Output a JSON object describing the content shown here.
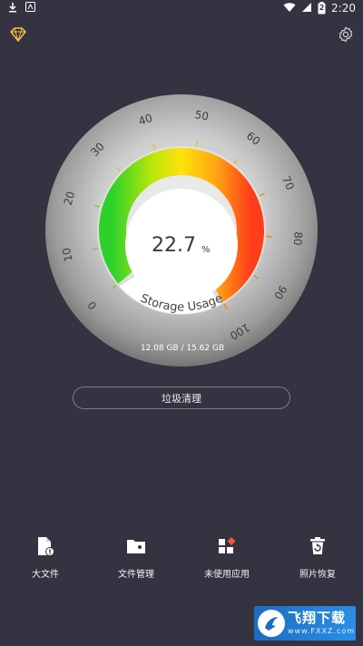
{
  "status_bar": {
    "time": "2:20",
    "battery": "2"
  },
  "icons": {
    "premium": "diamond-icon",
    "settings": "gear-icon",
    "download": "download-icon",
    "notification": "app-notification-icon",
    "wifi": "wifi-icon",
    "signal": "signal-icon",
    "battery": "battery-icon"
  },
  "gauge": {
    "percent_value": "22.7",
    "percent_unit": "%",
    "label": "Storage Usage",
    "storage_text": "12.08 GB / 15.62 GB",
    "ticks": [
      "0",
      "10",
      "20",
      "30",
      "40",
      "50",
      "60",
      "70",
      "80",
      "90",
      "100"
    ],
    "usage_fraction": 0.227
  },
  "actions": {
    "clean_label": "垃圾清理"
  },
  "bottom_nav": [
    {
      "label": "大文件",
      "icon": "large-file-icon"
    },
    {
      "label": "文件管理",
      "icon": "folder-icon"
    },
    {
      "label": "未使用应用",
      "icon": "unused-apps-icon"
    },
    {
      "label": "照片恢复",
      "icon": "photo-restore-icon"
    }
  ],
  "watermark": {
    "title": "飞翔下载",
    "url": "www.FXXZ.com"
  },
  "colors": {
    "background": "#353241",
    "accent": "#f6c24a"
  }
}
